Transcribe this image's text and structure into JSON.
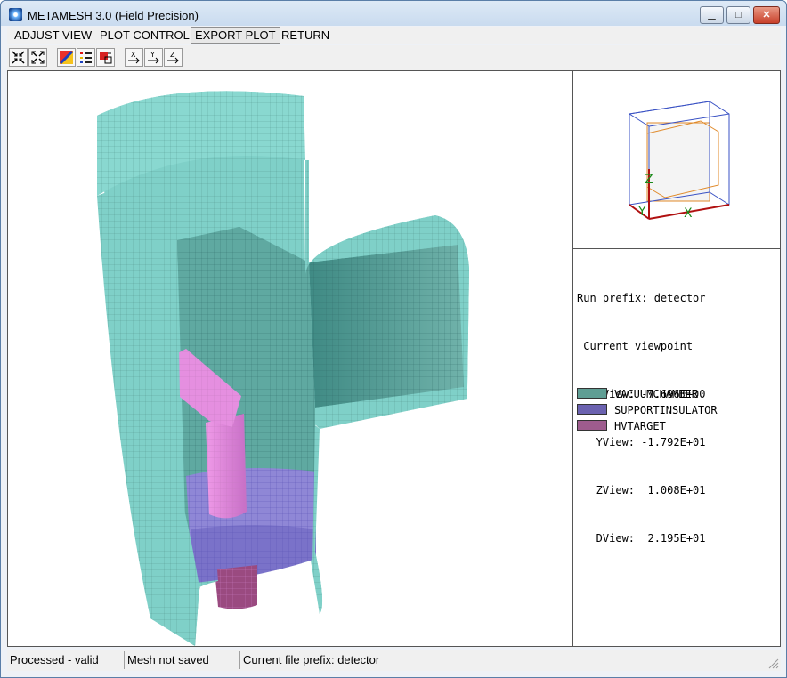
{
  "window": {
    "title": "METAMESH 3.0 (Field Precision)",
    "minimize": "▁",
    "maximize": "□",
    "close": "✕"
  },
  "menu": [
    {
      "label": "ADJUST VIEW"
    },
    {
      "label": "PLOT CONTROL"
    },
    {
      "label": "EXPORT PLOT"
    },
    {
      "label": "RETURN"
    }
  ],
  "toolbar": {
    "icons": [
      "zoom-in-icon",
      "zoom-out-icon",
      "color-plot-icon",
      "legend-icon",
      "region-icon",
      "view-x-icon",
      "view-y-icon",
      "view-z-icon"
    ],
    "axis_x": "X",
    "axis_y": "Y",
    "axis_z": "Z"
  },
  "orientation": {
    "x_label": "X",
    "y_label": "Y",
    "z_label": "Z"
  },
  "info": {
    "run_prefix": "Run prefix: detector",
    "viewpoint_title": " Current viewpoint",
    "xview": "   XView: -7.696E+00",
    "yview": "   YView: -1.792E+01",
    "zview": "   ZView:  1.008E+01",
    "dview": "   DView:  2.195E+01"
  },
  "legend": [
    {
      "label": "VACUUMCHAMBER",
      "color": "#5f9e94"
    },
    {
      "label": "SUPPORTINSULATOR",
      "color": "#6b62b0"
    },
    {
      "label": "HVTARGET",
      "color": "#9e5c8e"
    }
  ],
  "status": {
    "validity": "Processed - valid",
    "mesh": "Mesh not saved",
    "file_prefix": "Current file prefix: detector"
  }
}
